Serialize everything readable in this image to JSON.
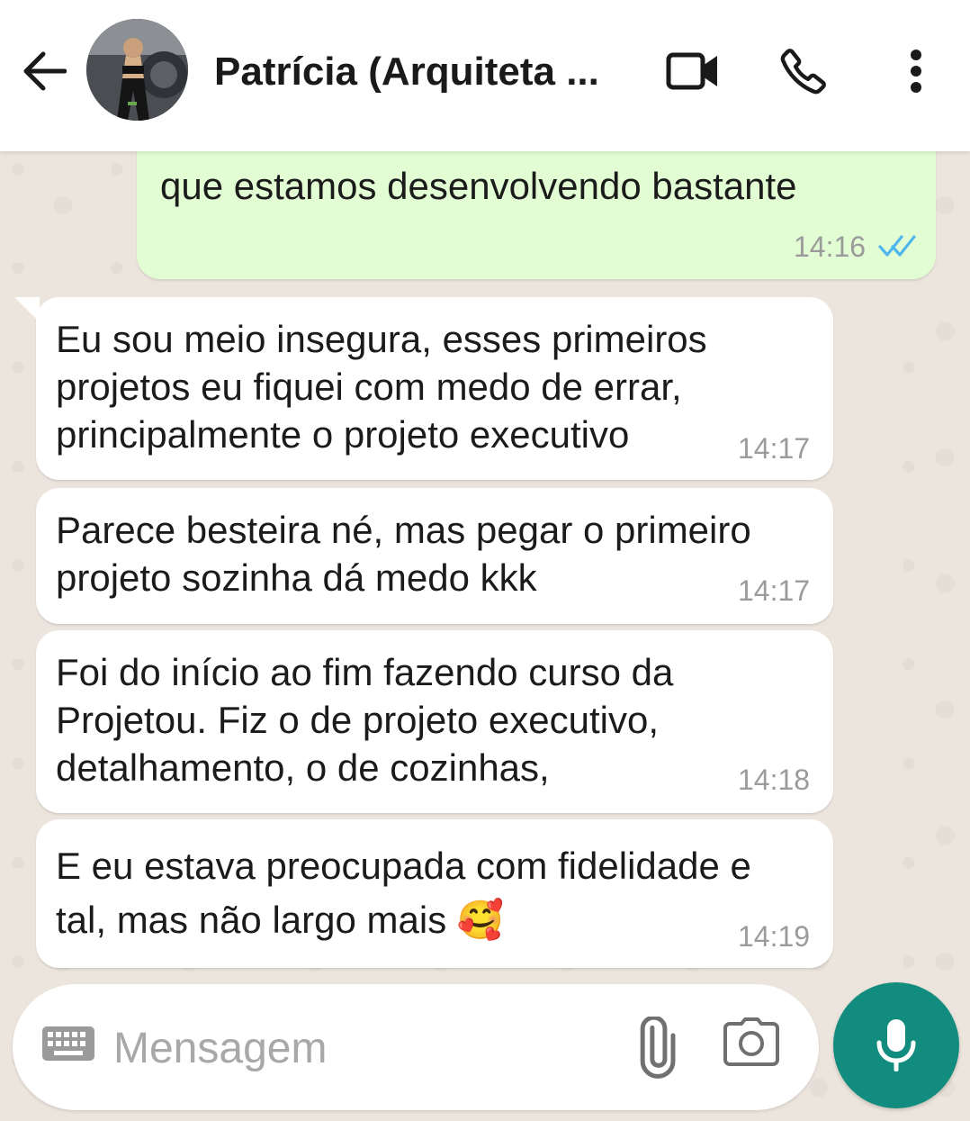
{
  "header": {
    "contact_name": "Patrícia (Arquiteta ...",
    "icons": [
      "back-arrow-icon",
      "avatar",
      "video-call-icon",
      "phone-icon",
      "more-vert-icon"
    ]
  },
  "messages": [
    {
      "direction": "outgoing",
      "text": "que estamos desenvolvendo bastante",
      "time": "14:16",
      "status": "read"
    },
    {
      "direction": "incoming",
      "text": "Eu sou meio insegura, esses primeiros\nprojetos eu fiquei com medo de errar,\nprincipalmente o projeto executivo",
      "time": "14:17"
    },
    {
      "direction": "incoming",
      "text": "Parece besteira né, mas pegar o primeiro\nprojeto sozinha dá medo kkk",
      "time": "14:17"
    },
    {
      "direction": "incoming",
      "text": "Foi do início ao fim fazendo curso da\nProjetou. Fiz o de projeto executivo,\ndetalhamento, o de cozinhas,",
      "time": "14:18"
    },
    {
      "direction": "incoming",
      "text": "E eu estava preocupada com fidelidade e\ntal, mas não largo mais 🥰",
      "time": "14:19"
    }
  ],
  "composer": {
    "placeholder": "Mensagem"
  },
  "colors": {
    "outgoing_bubble": "#e2fdd4",
    "incoming_bubble": "#ffffff",
    "accent": "#128c7e",
    "read_ticks": "#4fb6ec"
  }
}
